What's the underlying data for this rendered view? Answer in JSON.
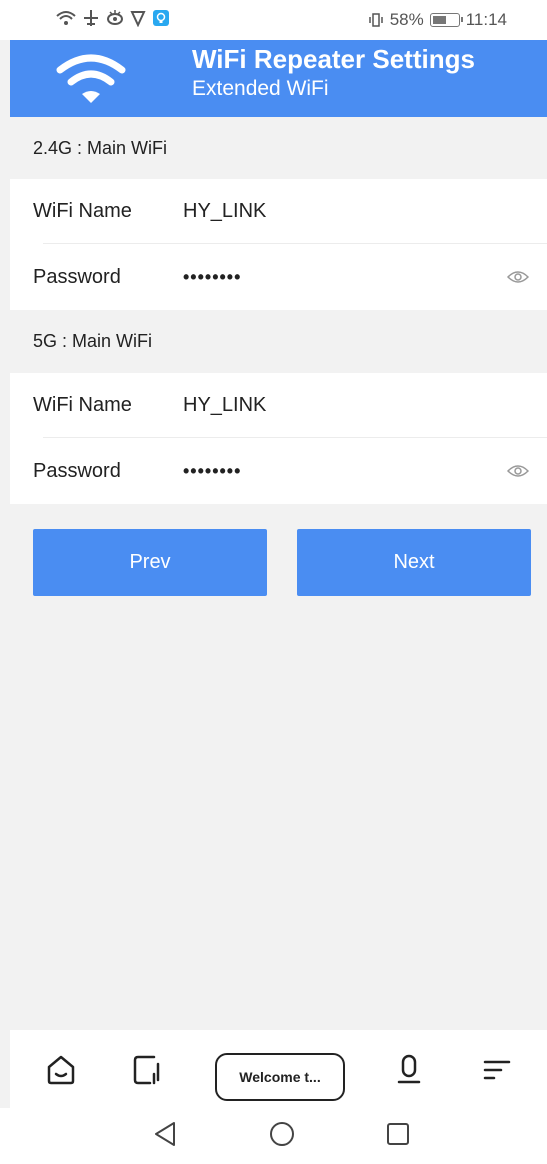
{
  "status_bar": {
    "battery_percent": "58%",
    "battery_level": 0.58,
    "time": "11:14",
    "left_icons": [
      "wifi-icon",
      "airplane-icon",
      "eye-comfort-icon",
      "location-icon",
      "app-notification-icon"
    ],
    "right_icons": [
      "vibrate-icon",
      "battery-icon"
    ]
  },
  "header": {
    "title": "WiFi Repeater Settings",
    "subtitle": "Extended WiFi",
    "logo_icon": "wifi-logo-icon",
    "color": "#4a8df2"
  },
  "sections": [
    {
      "title": "2.4G : Main WiFi",
      "wifi_name_label": "WiFi Name",
      "wifi_name_value": "HY_LINK",
      "password_label": "Password",
      "password_value": "••••••••",
      "password_toggle_icon": "eye-icon"
    },
    {
      "title": "5G : Main WiFi",
      "wifi_name_label": "WiFi Name",
      "wifi_name_value": "HY_LINK",
      "password_label": "Password",
      "password_value": "••••••••",
      "password_toggle_icon": "eye-icon"
    }
  ],
  "buttons": {
    "prev": "Prev",
    "next": "Next"
  },
  "browser_bar": {
    "url_text": "Welcome t...",
    "icons": [
      "home-icon",
      "tabs-icon",
      "microphone-icon",
      "menu-icon"
    ]
  },
  "nav_bar": {
    "icons": [
      "back-icon",
      "home-circle-icon",
      "recents-icon"
    ]
  }
}
